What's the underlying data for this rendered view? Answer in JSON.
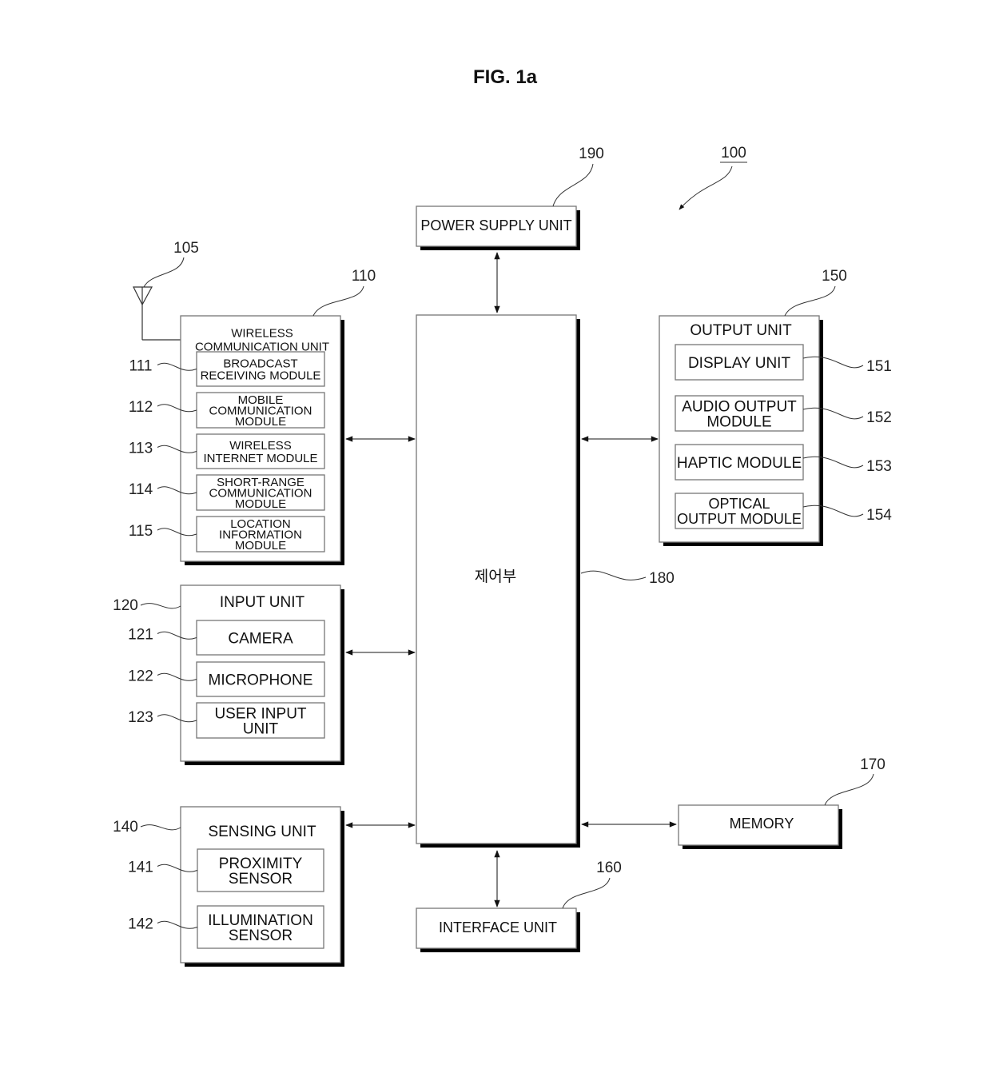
{
  "figure": {
    "title": "FIG. 1a",
    "device_ref": "100"
  },
  "antenna": {
    "ref": "105"
  },
  "controller": {
    "ref": "180",
    "label": "제어부"
  },
  "power_supply": {
    "ref": "190",
    "label": "POWER SUPPLY UNIT"
  },
  "interface": {
    "ref": "160",
    "label": "INTERFACE UNIT"
  },
  "memory": {
    "ref": "170",
    "label": "MEMORY"
  },
  "wireless": {
    "ref": "110",
    "label_lines": [
      "WIRELESS",
      "COMMUNICATION UNIT"
    ],
    "modules": [
      {
        "ref": "111",
        "lines": [
          "BROADCAST",
          "RECEIVING MODULE"
        ]
      },
      {
        "ref": "112",
        "lines": [
          "MOBILE",
          "COMMUNICATION",
          "MODULE"
        ]
      },
      {
        "ref": "113",
        "lines": [
          "WIRELESS",
          "INTERNET MODULE"
        ]
      },
      {
        "ref": "114",
        "lines": [
          "SHORT-RANGE",
          "COMMUNICATION",
          "MODULE"
        ]
      },
      {
        "ref": "115",
        "lines": [
          "LOCATION",
          "INFORMATION",
          "MODULE"
        ]
      }
    ]
  },
  "input": {
    "ref": "120",
    "label_lines": [
      "INPUT UNIT"
    ],
    "modules": [
      {
        "ref": "121",
        "lines": [
          "CAMERA"
        ]
      },
      {
        "ref": "122",
        "lines": [
          "MICROPHONE"
        ]
      },
      {
        "ref": "123",
        "lines": [
          "USER INPUT",
          "UNIT"
        ]
      }
    ]
  },
  "sensing": {
    "ref": "140",
    "label_lines": [
      "SENSING UNIT"
    ],
    "modules": [
      {
        "ref": "141",
        "lines": [
          "PROXIMITY",
          "SENSOR"
        ]
      },
      {
        "ref": "142",
        "lines": [
          "ILLUMINATION",
          "SENSOR"
        ]
      }
    ]
  },
  "output": {
    "ref": "150",
    "label_lines": [
      "OUTPUT UNIT"
    ],
    "modules": [
      {
        "ref": "151",
        "lines": [
          "DISPLAY UNIT"
        ]
      },
      {
        "ref": "152",
        "lines": [
          "AUDIO OUTPUT",
          "MODULE"
        ]
      },
      {
        "ref": "153",
        "lines": [
          "HAPTIC MODULE"
        ]
      },
      {
        "ref": "154",
        "lines": [
          "OPTICAL",
          "OUTPUT MODULE"
        ]
      }
    ]
  }
}
